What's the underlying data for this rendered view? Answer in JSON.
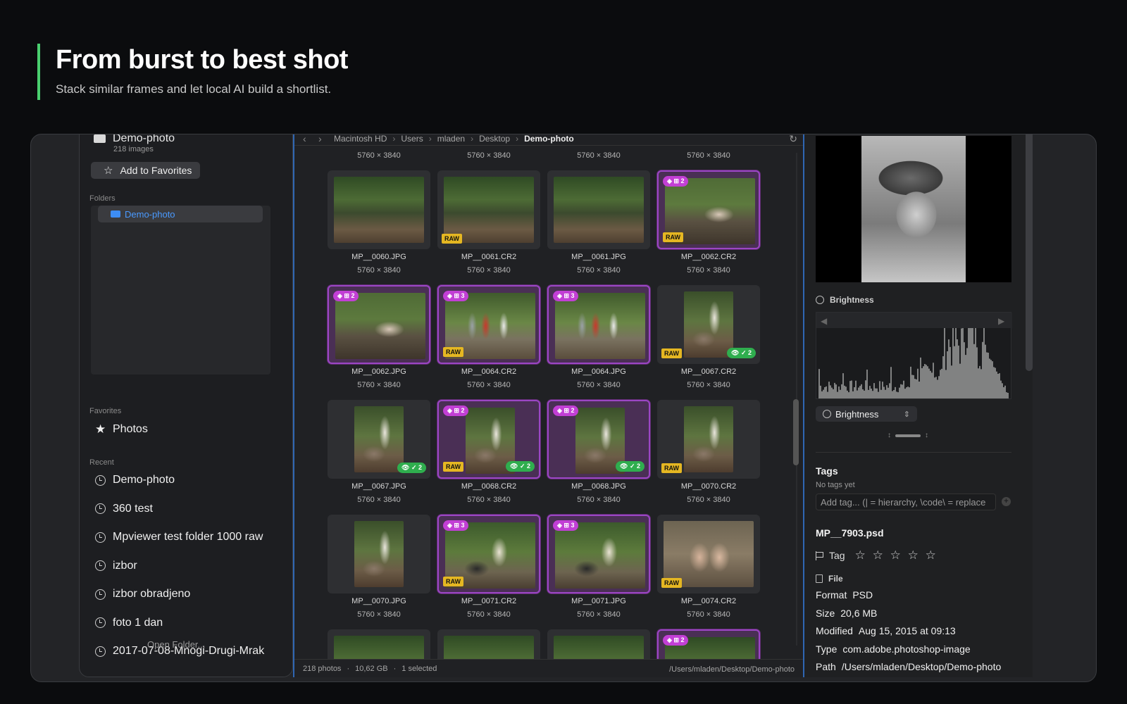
{
  "hero": {
    "title": "From burst to best shot",
    "subtitle": "Stack similar frames and let local AI build a shortlist."
  },
  "sidebar": {
    "folder_name": "Demo-photo",
    "folder_count": "218 images",
    "fav_button": "Add to Favorites",
    "folders_label": "Folders",
    "selected_folder": "Demo-photo",
    "favorites_label": "Favorites",
    "favorite_item": "Photos",
    "recent_label": "Recent",
    "recent": [
      "Demo-photo",
      "360 test",
      "Mpviewer test folder 1000 raw",
      "izbor",
      "izbor obradjeno",
      "foto 1 dan",
      "2017-07-08-Mnogi-Drugi-Mrak"
    ],
    "open_folder": "Open Folder..."
  },
  "breadcrumb": {
    "items": [
      "Macintosh HD",
      "Users",
      "mladen",
      "Desktop"
    ],
    "current": "Demo-photo"
  },
  "grid": {
    "dim": "5760 × 3840",
    "rows": [
      [
        {
          "name": "MP__0060.JPG",
          "pic": "wood"
        },
        {
          "name": "MP__0061.CR2",
          "pic": "wood",
          "raw": true
        },
        {
          "name": "MP__0061.JPG",
          "pic": "wood"
        },
        {
          "name": "MP__0062.CR2",
          "pic": "ground",
          "raw": true,
          "stack": "⊞ 2"
        }
      ],
      [
        {
          "name": "MP__0062.JPG",
          "pic": "ground",
          "stack": "⊞ 2"
        },
        {
          "name": "MP__0064.CR2",
          "pic": "group",
          "raw": true,
          "stack": "⊞ 3"
        },
        {
          "name": "MP__0064.JPG",
          "pic": "group",
          "stack": "⊞ 3"
        },
        {
          "name": "MP__0067.CR2",
          "pic": "tall",
          "raw": true,
          "view": "✓ 2"
        }
      ],
      [
        {
          "name": "MP__0067.JPG",
          "pic": "tall",
          "view": "✓ 2"
        },
        {
          "name": "MP__0068.CR2",
          "pic": "tall",
          "raw": true,
          "stack": "⊞ 2",
          "view": "✓ 2"
        },
        {
          "name": "MP__0068.JPG",
          "pic": "tall",
          "stack": "⊞ 2",
          "view": "✓ 2"
        },
        {
          "name": "MP__0070.CR2",
          "pic": "tall",
          "raw": true
        }
      ],
      [
        {
          "name": "MP__0070.JPG",
          "pic": "tall"
        },
        {
          "name": "MP__0071.CR2",
          "pic": "group2",
          "raw": true,
          "stack": "⊞ 3"
        },
        {
          "name": "MP__0071.JPG",
          "pic": "group2",
          "stack": "⊞ 3"
        },
        {
          "name": "MP__0074.CR2",
          "pic": "feet",
          "raw": true
        }
      ],
      [
        {
          "name": "",
          "pic": "wood"
        },
        {
          "name": "",
          "pic": "wood"
        },
        {
          "name": "",
          "pic": "wood"
        },
        {
          "name": "",
          "pic": "wood",
          "stack": "⊞ 2"
        }
      ]
    ]
  },
  "status": {
    "photos": "218 photos",
    "size": "10,62 GB",
    "selected": "1 selected",
    "path": "/Users/mladen/Desktop/Demo-photo"
  },
  "inspector": {
    "brightness_label": "Brightness",
    "select_value": "Brightness",
    "tags_title": "Tags",
    "no_tags": "No tags yet",
    "tag_placeholder": "Add tag... (| = hierarchy, \\code\\ = replace",
    "file_name": "MP__7903.psd",
    "tag_label": "Tag",
    "file_section": "File",
    "props": [
      {
        "k": "Format",
        "v": "PSD"
      },
      {
        "k": "Size",
        "v": "20,6 MB"
      },
      {
        "k": "Modified",
        "v": "Aug 15, 2015 at 09:13"
      },
      {
        "k": "Type",
        "v": "com.adobe.photoshop-image"
      },
      {
        "k": "Path",
        "v": "/Users/mladen/Desktop/Demo-photo"
      }
    ]
  },
  "colors": {
    "accent_green": "#4ad06f",
    "stack_purple": "#9b46c4",
    "raw_yellow": "#e5b722",
    "folder_blue": "#3d8df5"
  }
}
